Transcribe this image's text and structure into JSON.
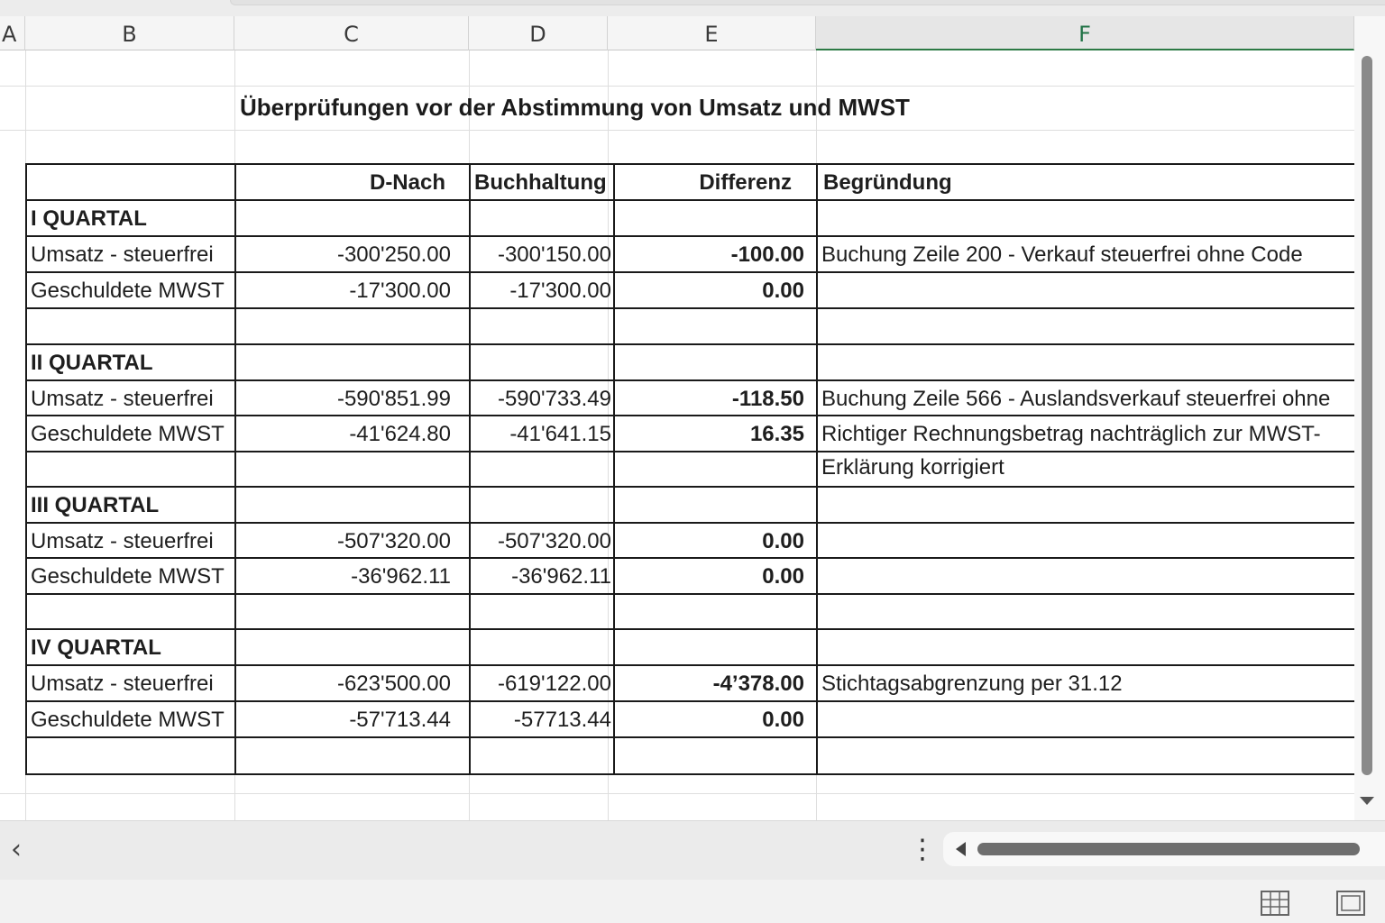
{
  "sheet": {
    "columns": [
      "A",
      "B",
      "C",
      "D",
      "E",
      "F"
    ],
    "selected_column": "F",
    "title": "Überprüfungen vor der Abstimmung von Umsatz und MWST"
  },
  "table": {
    "headers": [
      "",
      "D-Nach",
      "Buchhaltung",
      "Differenz",
      "Begründung"
    ],
    "rows": [
      {
        "label": "I QUARTAL",
        "section": true,
        "c": "",
        "d": "",
        "e": "",
        "f": ""
      },
      {
        "label": "Umsatz - steuerfrei",
        "c": "-300'250.00",
        "d": "-300'150.00",
        "e": "-100.00",
        "f": "Buchung Zeile 200 - Verkauf steuerfrei ohne  Code"
      },
      {
        "label": "Geschuldete MWST",
        "c": "-17'300.00",
        "d": "-17'300.00",
        "e": "0.00",
        "f": ""
      },
      {
        "label": "",
        "c": "",
        "d": "",
        "e": "",
        "f": ""
      },
      {
        "label": "II QUARTAL",
        "section": true,
        "c": "",
        "d": "",
        "e": "",
        "f": ""
      },
      {
        "label": "Umsatz - steuerfrei",
        "c": "-590'851.99",
        "d": "-590'733.49",
        "e": "-118.50",
        "f": "Buchung Zeile 566 - Auslandsverkauf steuerfrei ohne"
      },
      {
        "label": "Geschuldete MWST",
        "c": "-41'624.80",
        "d": "-41'641.15",
        "e": "16.35",
        "f": "Richtiger Rechnungsbetrag nachträglich zur MWST-"
      },
      {
        "label": "",
        "c": "",
        "d": "",
        "e": "",
        "f": "Erklärung korrigiert"
      },
      {
        "label": "III QUARTAL",
        "section": true,
        "c": "",
        "d": "",
        "e": "",
        "f": ""
      },
      {
        "label": "Umsatz - steuerfrei",
        "c": "-507'320.00",
        "d": "-507'320.00",
        "e": "0.00",
        "f": ""
      },
      {
        "label": "Geschuldete MWST",
        "c": "-36'962.11",
        "d": "-36'962.11",
        "e": "0.00",
        "f": ""
      },
      {
        "label": "",
        "c": "",
        "d": "",
        "e": "",
        "f": ""
      },
      {
        "label": "IV QUARTAL",
        "section": true,
        "c": "",
        "d": "",
        "e": "",
        "f": ""
      },
      {
        "label": "Umsatz - steuerfrei",
        "c": "-623'500.00",
        "d": "-619'122.00",
        "e": "-4’378.00",
        "f": "Stichtagsabgrenzung per 31.12"
      },
      {
        "label": "Geschuldete MWST",
        "c": "-57'713.44",
        "d": "-57713.44",
        "e": "0.00",
        "f": ""
      },
      {
        "label": "",
        "c": "",
        "d": "",
        "e": "",
        "f": ""
      }
    ]
  },
  "icons": {
    "back": "chevron-left-icon",
    "more": "more-vertical-icon",
    "normal_view": "grid-view-icon",
    "page_view": "page-layout-icon"
  },
  "colors": {
    "selected_column_accent": "#217346",
    "table_border": "#1a1a1a",
    "gridline": "#dedede"
  }
}
